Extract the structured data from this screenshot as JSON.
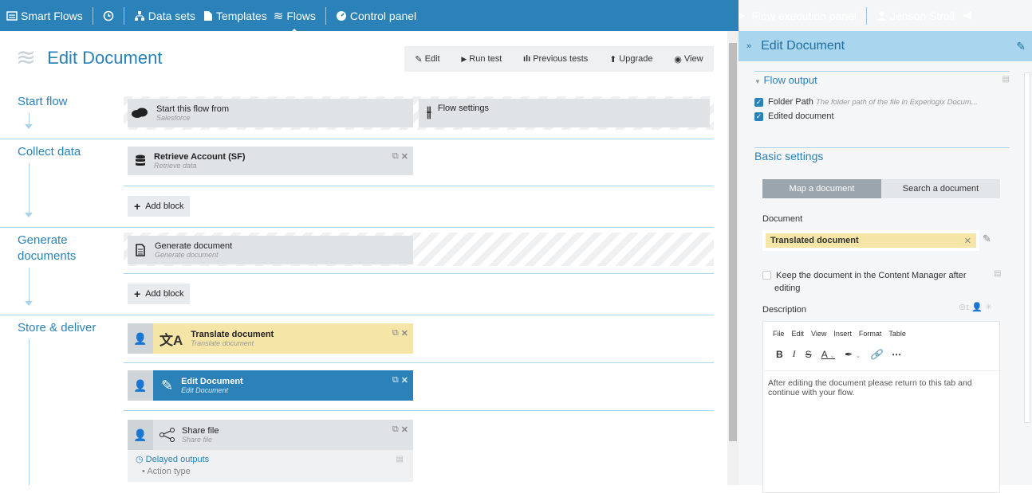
{
  "topbar": {
    "brand": "Smart Flows",
    "datasets": "Data sets",
    "templates": "Templates",
    "flows": "Flows",
    "control_panel": "Control panel",
    "execution_panel": "Flow execution panel",
    "user": "Jenson Stroll"
  },
  "page": {
    "title": "Edit Document"
  },
  "toolbar": {
    "edit": "Edit",
    "run_test": "Run test",
    "previous_tests": "Previous tests",
    "upgrade": "Upgrade",
    "view": "View"
  },
  "sections": {
    "start": "Start flow",
    "collect": "Collect data",
    "generate": "Generate documents",
    "store": "Store & deliver"
  },
  "blocks": {
    "start": {
      "title": "Start this flow from",
      "sub": "Salesforce"
    },
    "flow_settings": "Flow settings",
    "retrieve": {
      "title": "Retrieve Account (SF)",
      "sub": "Retrieve data"
    },
    "generate": {
      "title": "Generate document",
      "sub": "Generate document"
    },
    "translate": {
      "title": "Translate document",
      "sub": "Translate document"
    },
    "edit": {
      "title": "Edit Document",
      "sub": "Edit Document"
    },
    "share": {
      "title": "Share file",
      "sub": "Share file"
    },
    "delayed": "Delayed outputs",
    "action_type": "Action type"
  },
  "add_block": "Add block",
  "panel": {
    "title": "Edit Document",
    "flow_output": "Flow output",
    "outputs": [
      {
        "label": "Folder Path",
        "desc": "The folder path of the file in Experlogix Docum..."
      },
      {
        "label": "Edited document",
        "desc": ""
      }
    ],
    "basic_settings": "Basic settings",
    "tab_map": "Map a document",
    "tab_search": "Search a document",
    "document_label": "Document",
    "document_value": "Translated document",
    "keep_label": "Keep the document in the Content Manager after editing",
    "description_label": "Description",
    "menu": [
      "File",
      "Edit",
      "View",
      "Insert",
      "Format",
      "Table"
    ],
    "editor_text": "After editing the document please return to this tab and continue with your flow."
  },
  "colors": {
    "primary": "#2a82b8",
    "highlight": "#f5e6a8",
    "panel_header": "#a9d6ee"
  }
}
